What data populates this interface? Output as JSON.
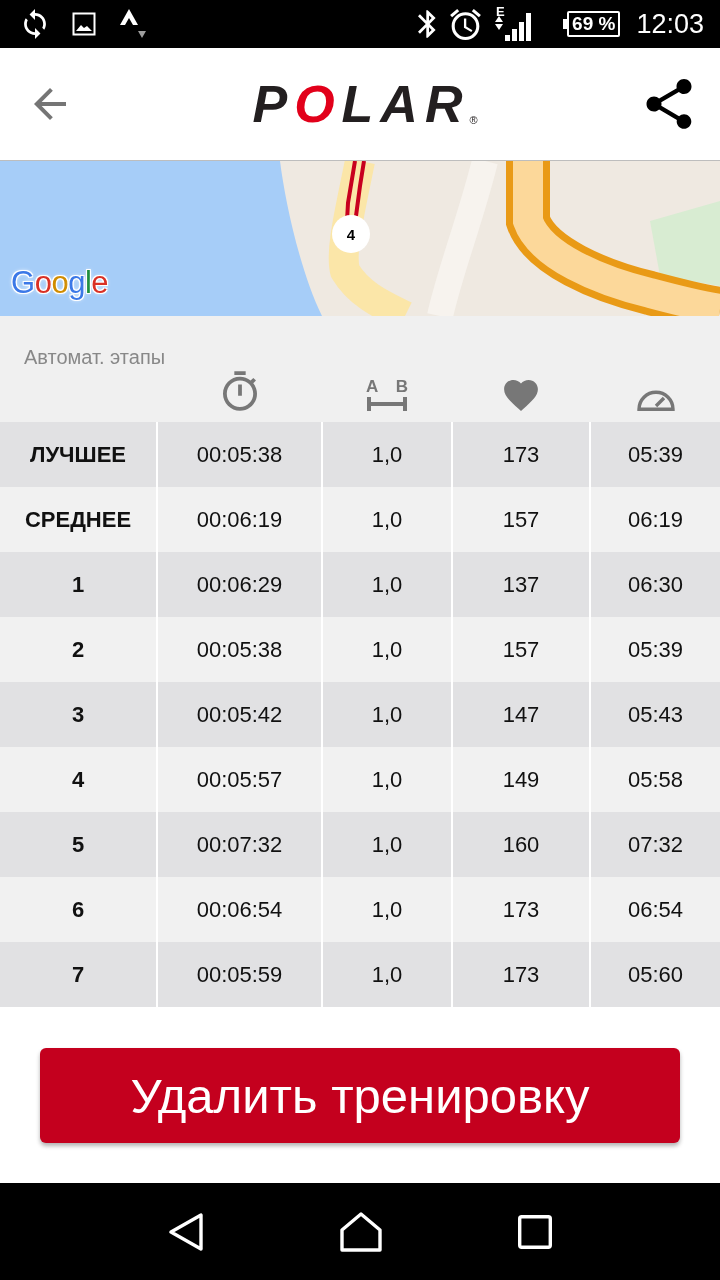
{
  "status_bar": {
    "network": "E",
    "battery": "69 %",
    "time": "12:03"
  },
  "app_bar": {
    "logo": {
      "text": "POLAR",
      "mark": "®"
    }
  },
  "map": {
    "marker": "4",
    "attribution": "Google"
  },
  "laps": {
    "title": "Автомат. этапы",
    "columns": [
      {
        "kind": "time"
      },
      {
        "kind": "distance",
        "start": "A",
        "end": "B"
      },
      {
        "kind": "heart_rate"
      },
      {
        "kind": "pace"
      }
    ],
    "rows": [
      {
        "label": "ЛУЧШЕЕ",
        "values": [
          "00:05:38",
          "1,0",
          "173",
          "05:39"
        ]
      },
      {
        "label": "СРЕДНЕЕ",
        "values": [
          "00:06:19",
          "1,0",
          "157",
          "06:19"
        ]
      },
      {
        "label": "1",
        "values": [
          "00:06:29",
          "1,0",
          "137",
          "06:30"
        ]
      },
      {
        "label": "2",
        "values": [
          "00:05:38",
          "1,0",
          "157",
          "05:39"
        ]
      },
      {
        "label": "3",
        "values": [
          "00:05:42",
          "1,0",
          "147",
          "05:43"
        ]
      },
      {
        "label": "4",
        "values": [
          "00:05:57",
          "1,0",
          "149",
          "05:58"
        ]
      },
      {
        "label": "5",
        "values": [
          "00:07:32",
          "1,0",
          "160",
          "07:32"
        ]
      },
      {
        "label": "6",
        "values": [
          "00:06:54",
          "1,0",
          "173",
          "06:54"
        ]
      },
      {
        "label": "7",
        "values": [
          "00:05:59",
          "1,0",
          "173",
          "05:60"
        ]
      }
    ]
  },
  "delete_button": {
    "label": "Удалить тренировку"
  }
}
